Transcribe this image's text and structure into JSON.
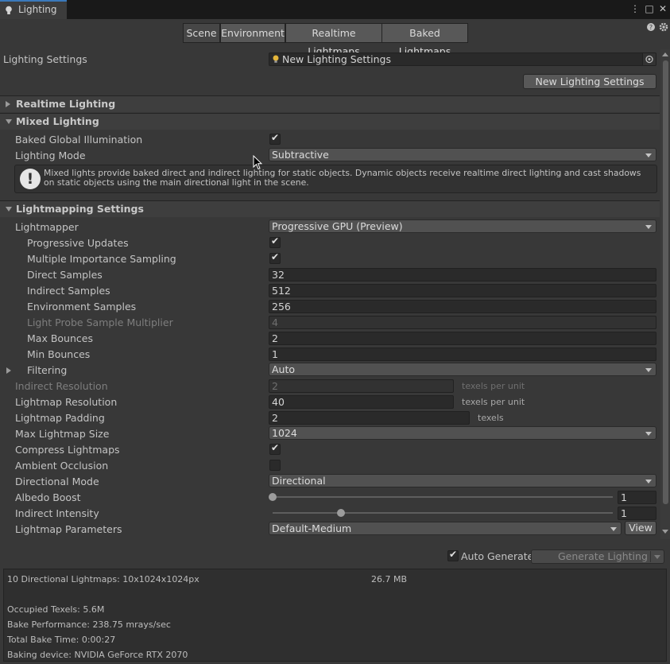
{
  "window": {
    "tab_title": "Lighting",
    "menu_icon": "kebab-menu-icon",
    "maximize_icon": "maximize-icon",
    "close_icon": "close-icon"
  },
  "toolbar_tabs": [
    "Scene",
    "Environment",
    "Realtime Lightmaps",
    "Baked Lightmaps"
  ],
  "active_tab": "Scene",
  "header_icons": [
    "help-icon",
    "settings-icon"
  ],
  "lighting_settings": {
    "label": "Lighting Settings",
    "asset": "New Lighting Settings",
    "new_button": "New Lighting Settings"
  },
  "sections": {
    "realtime": "Realtime Lighting",
    "mixed": "Mixed Lighting",
    "lightmapping": "Lightmapping Settings"
  },
  "mixed": {
    "baked_gi_label": "Baked Global Illumination",
    "baked_gi_checked": true,
    "lighting_mode_label": "Lighting Mode",
    "lighting_mode_value": "Subtractive",
    "info_text": "Mixed lights provide baked direct and indirect lighting for static objects. Dynamic objects receive realtime direct lighting and cast shadows on static objects using the main directional light in the scene."
  },
  "lightmapping": {
    "lightmapper": {
      "label": "Lightmapper",
      "value": "Progressive GPU (Preview)"
    },
    "progressive_updates": {
      "label": "Progressive Updates",
      "checked": true
    },
    "mis": {
      "label": "Multiple Importance Sampling",
      "checked": true
    },
    "direct_samples": {
      "label": "Direct Samples",
      "value": "32"
    },
    "indirect_samples": {
      "label": "Indirect Samples",
      "value": "512"
    },
    "environment_samples": {
      "label": "Environment Samples",
      "value": "256"
    },
    "light_probe_multiplier": {
      "label": "Light Probe Sample Multiplier",
      "value": "4"
    },
    "max_bounces": {
      "label": "Max Bounces",
      "value": "2"
    },
    "min_bounces": {
      "label": "Min Bounces",
      "value": "1"
    },
    "filtering": {
      "label": "Filtering",
      "value": "Auto"
    },
    "indirect_resolution": {
      "label": "Indirect Resolution",
      "value": "2",
      "unit": "texels per unit"
    },
    "lightmap_resolution": {
      "label": "Lightmap Resolution",
      "value": "40",
      "unit": "texels per unit"
    },
    "lightmap_padding": {
      "label": "Lightmap Padding",
      "value": "2",
      "unit": "texels"
    },
    "max_lightmap_size": {
      "label": "Max Lightmap Size",
      "value": "1024"
    },
    "compress_lightmaps": {
      "label": "Compress Lightmaps",
      "checked": true
    },
    "ambient_occlusion": {
      "label": "Ambient Occlusion",
      "checked": false
    },
    "directional_mode": {
      "label": "Directional Mode",
      "value": "Directional"
    },
    "albedo_boost": {
      "label": "Albedo Boost",
      "value": "1",
      "slider_fraction": 0.0
    },
    "indirect_intensity": {
      "label": "Indirect Intensity",
      "value": "1",
      "slider_fraction": 0.2
    },
    "lightmap_parameters": {
      "label": "Lightmap Parameters",
      "value": "Default-Medium",
      "view_button": "View"
    }
  },
  "footer": {
    "auto_generate_label": "Auto Generate",
    "auto_generate_checked": true,
    "generate_button": "Generate Lighting"
  },
  "stats": {
    "lightmaps": "10 Directional Lightmaps: 10x1024x1024px",
    "size": "26.7 MB",
    "occupied": "Occupied Texels: 5.6M",
    "performance": "Bake Performance: 238.75 mrays/sec",
    "total_time": "Total Bake Time: 0:00:27",
    "device": "Baking device: NVIDIA GeForce RTX 2070"
  }
}
